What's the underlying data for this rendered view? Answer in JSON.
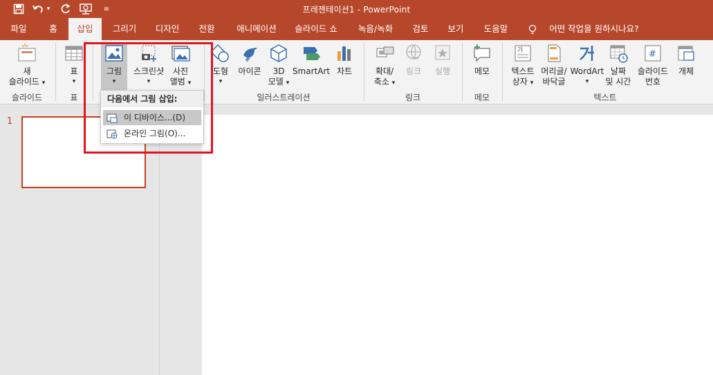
{
  "window": {
    "title": "프레젠테이션1  -  PowerPoint"
  },
  "tabs": [
    "파일",
    "홈",
    "삽입",
    "그리기",
    "디자인",
    "전환",
    "애니메이션",
    "슬라이드 쇼",
    "녹음/녹화",
    "검토",
    "보기",
    "도움말",
    "어떤 작업을 원하시나요?"
  ],
  "ribbon": {
    "new_slide": [
      "새",
      "슬라이드"
    ],
    "table": "표",
    "picture": "그림",
    "screenshot": "스크린샷",
    "photo_album": [
      "사진",
      "앨범"
    ],
    "shapes": "도형",
    "icons": "아이콘",
    "models3d": [
      "3D",
      "모델"
    ],
    "smartart": "SmartArt",
    "chart": "차트",
    "zoom": [
      "확대/",
      "축소"
    ],
    "link": "링크",
    "action": "실행",
    "comment": "메모",
    "textbox": [
      "텍스트",
      "상자"
    ],
    "header_footer": [
      "머리글/",
      "바닥글"
    ],
    "wordart": "WordArt",
    "date_time": [
      "날짜",
      "및 시간"
    ],
    "slide_number": [
      "슬라이드",
      "번호"
    ],
    "object": "개체",
    "groups": {
      "slides": "슬라이드",
      "tables": "표",
      "illustrations": "일러스트레이션",
      "links": "링크",
      "comments": "메모",
      "text": "텍스트"
    }
  },
  "thumbnail": {
    "number": "1"
  },
  "picture_menu": {
    "header": "다음에서 그림 삽입:",
    "item1": "이 디바이스...(D)",
    "item2": "온라인 그림(O)..."
  },
  "colors": {
    "accent": "#b7472a",
    "highlight_box": "#e0141e"
  }
}
